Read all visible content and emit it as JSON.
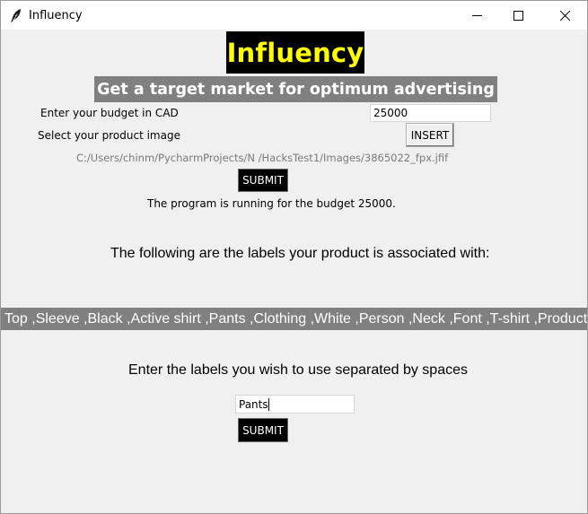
{
  "window": {
    "title": "Influency",
    "icon": "feather-icon"
  },
  "header": {
    "logo_text": "Influency",
    "logo_bg": "#000000",
    "logo_color": "#ffff00",
    "subtitle": "Get a target market for optimum advertising",
    "subtitle_bg": "#808080"
  },
  "budget": {
    "label": "Enter your budget in CAD",
    "value": "25000"
  },
  "image": {
    "label": "Select your product image",
    "insert_label": "INSERT",
    "path": "C:/Users/chinm/PycharmProjects/N  /HacksTest1/Images/3865022_fpx.jfif"
  },
  "submit1": {
    "label": "SUBMIT"
  },
  "status": {
    "text": "The program is running for the budget 25000."
  },
  "labels_section": {
    "heading": "The following are the labels your product is associated with:",
    "labels_text": "Top ,Sleeve ,Black ,Active shirt ,Pants ,Clothing ,White ,Person ,Neck ,Font ,T-shirt ,Product ,"
  },
  "selection": {
    "prompt": "Enter the labels you wish to use separated by spaces",
    "value": "Pants",
    "submit_label": "SUBMIT"
  }
}
